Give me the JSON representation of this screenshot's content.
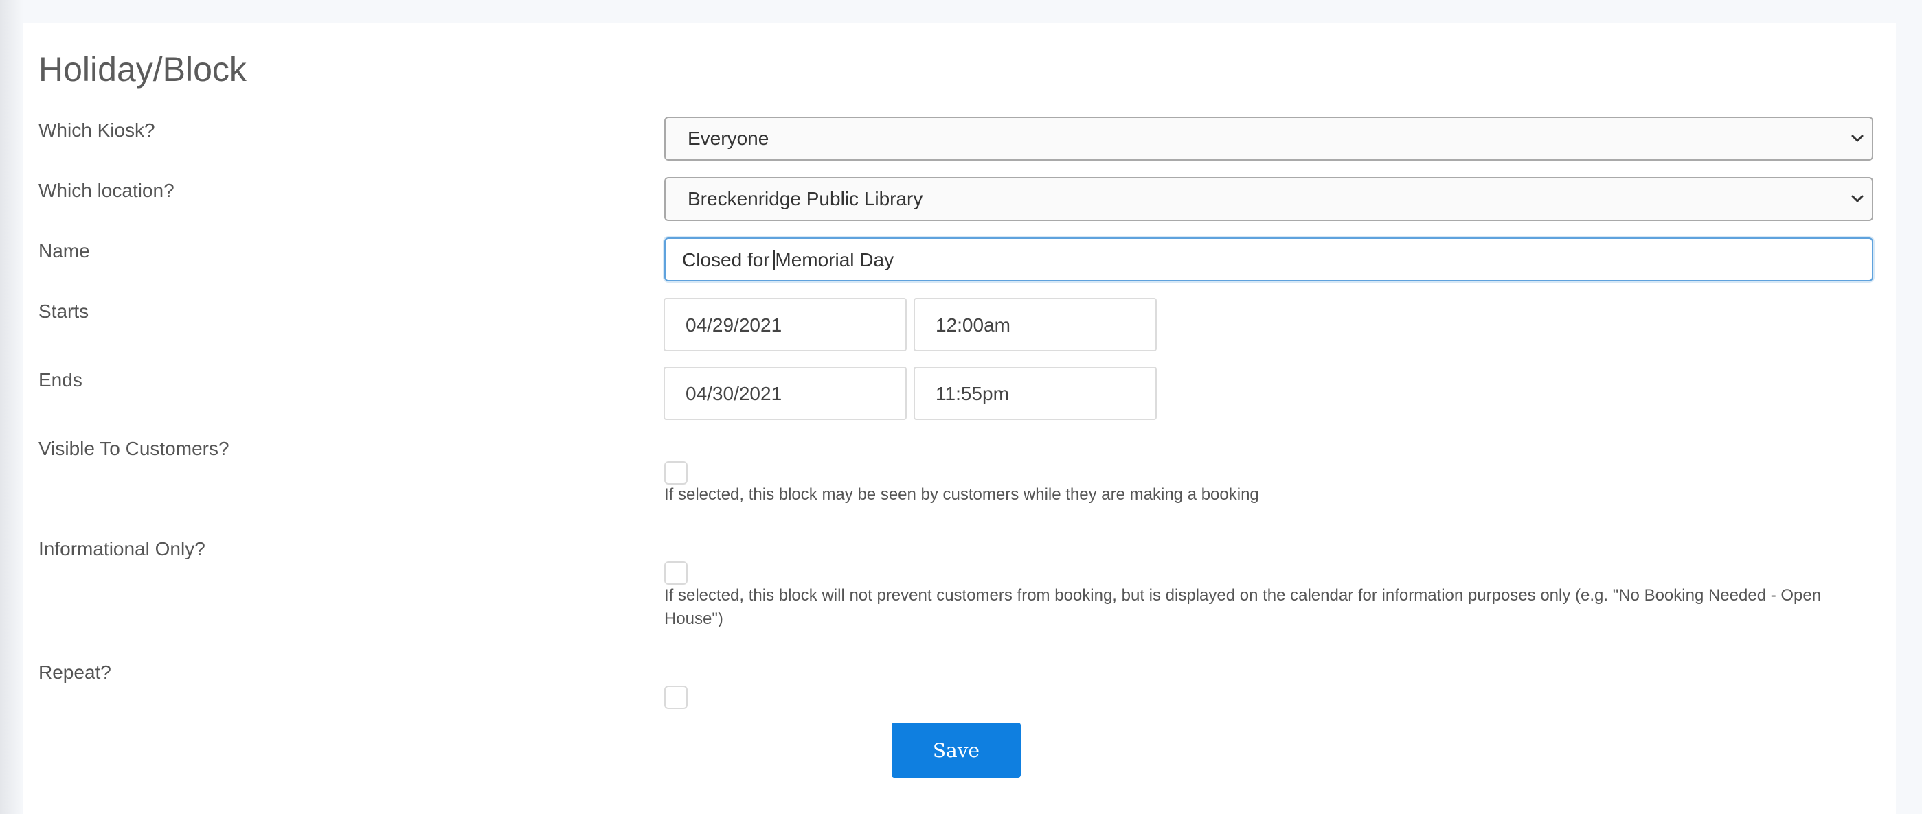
{
  "page": {
    "title": "Holiday/Block"
  },
  "form": {
    "kiosk": {
      "label": "Which Kiosk?",
      "value": "Everyone"
    },
    "location": {
      "label": "Which location?",
      "value": "Breckenridge Public Library"
    },
    "name": {
      "label": "Name",
      "value": "Closed for Memorial Day"
    },
    "starts": {
      "label": "Starts",
      "date": "04/29/2021",
      "time": "12:00am"
    },
    "ends": {
      "label": "Ends",
      "date": "04/30/2021",
      "time": "11:55pm"
    },
    "visible": {
      "label": "Visible To Customers?",
      "checked": false,
      "help": "If selected, this block may be seen by customers while they are making a booking"
    },
    "informational": {
      "label": "Informational Only?",
      "checked": false,
      "help": "If selected, this block will not prevent customers from booking, but is displayed on the calendar for information purposes only (e.g. \"No Booking Needed - Open House\")"
    },
    "repeat": {
      "label": "Repeat?",
      "checked": false
    },
    "save_label": "Save"
  },
  "colors": {
    "accent": "#0f7fe0",
    "focus_border": "#5fa2dd",
    "background": "#f6f8fb"
  },
  "icons": {
    "select_arrow": "chevron-down-icon"
  }
}
